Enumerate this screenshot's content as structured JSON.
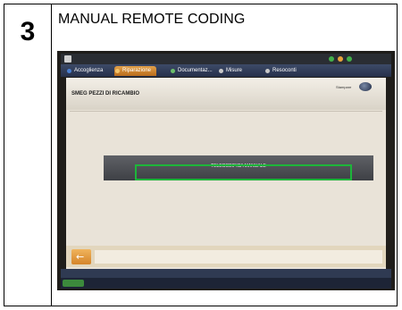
{
  "step": {
    "number": "3",
    "title": "MANUAL REMOTE CODING"
  },
  "screen": {
    "tabs": [
      {
        "label": "Accoglienza",
        "dot_color": "#4a7fd0"
      },
      {
        "label": "Riparazione",
        "dot_color": "#f3c46b"
      },
      {
        "label": "Documentaz...",
        "dot_color": "#6bbf6b"
      },
      {
        "label": "Misure",
        "dot_color": "#c9c9c9"
      },
      {
        "label": "Resoconti",
        "dot_color": "#c9c9c9"
      }
    ],
    "section_title": "SMEG PEZZI DI RICAMBIO",
    "header_button_label": "Stampare",
    "manual_button_label": "TELECODIFICA MANUALE",
    "highlight_color": "#1db53a"
  }
}
